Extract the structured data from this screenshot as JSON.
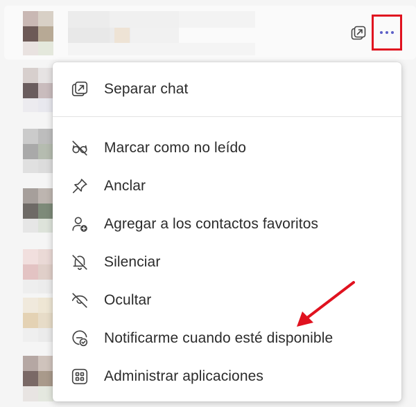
{
  "header": {
    "popout_icon": "popout-icon",
    "more_icon": "more-options-icon"
  },
  "menu": {
    "items": [
      {
        "label": "Separar chat",
        "icon": "popout-icon"
      },
      {
        "label": "Marcar como no leído",
        "icon": "mark-unread-icon"
      },
      {
        "label": "Anclar",
        "icon": "pin-icon"
      },
      {
        "label": "Agregar a los contactos favoritos",
        "icon": "add-favorite-contact-icon"
      },
      {
        "label": "Silenciar",
        "icon": "mute-bell-icon"
      },
      {
        "label": "Ocultar",
        "icon": "hide-eye-icon"
      },
      {
        "label": "Notificarme cuando esté disponible",
        "icon": "notify-status-icon"
      },
      {
        "label": "Administrar aplicaciones",
        "icon": "apps-grid-icon"
      }
    ]
  },
  "colors": {
    "accent": "#5b5fc7",
    "highlight": "#e0121f",
    "menu_bg": "#ffffff",
    "text": "#2b2b2b"
  }
}
